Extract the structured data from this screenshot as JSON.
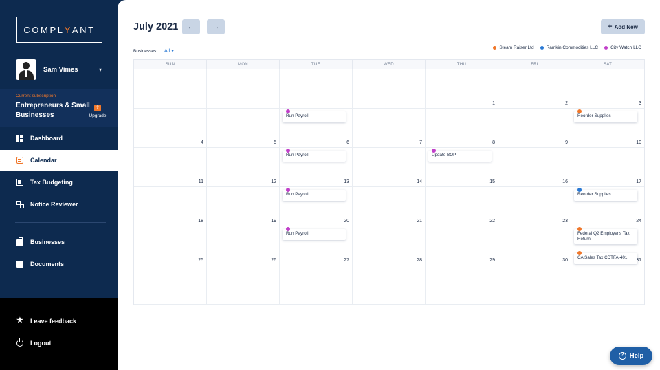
{
  "brand": {
    "logo_prefix": "COMPL",
    "logo_accent": "Y",
    "logo_suffix": "ANT"
  },
  "user": {
    "name": "Sam Vimes",
    "caret": "▾"
  },
  "subscription": {
    "label": "Current subscription",
    "plan": "Entrepreneurs & Small Businesses",
    "upgrade_label": "Upgrade"
  },
  "nav": {
    "dashboard": "Dashboard",
    "calendar": "Calendar",
    "tax_budgeting": "Tax Budgeting",
    "notice_reviewer": "Notice Reviewer",
    "businesses": "Businesses",
    "documents": "Documents",
    "leave_feedback": "Leave feedback",
    "logout": "Logout"
  },
  "header": {
    "month": "July 2021",
    "prev_arrow": "←",
    "next_arrow": "→",
    "add_new": "Add New",
    "add_icon": "+"
  },
  "filter": {
    "label": "Businesses:",
    "value": "All ▾"
  },
  "legend": [
    {
      "name": "Steam Raiser Ltd",
      "color": "#f0772a"
    },
    {
      "name": "Ramkin Commodities LLC",
      "color": "#2a79d4"
    },
    {
      "name": "City Watch LLC",
      "color": "#c13fc9"
    }
  ],
  "weekdays": [
    "SUN",
    "MON",
    "TUE",
    "WED",
    "THU",
    "FRI",
    "SAT"
  ],
  "days": [
    "",
    "",
    "",
    "",
    "1",
    "2",
    "3",
    "4",
    "5",
    "6",
    "7",
    "8",
    "9",
    "10",
    "11",
    "12",
    "13",
    "14",
    "15",
    "16",
    "17",
    "18",
    "19",
    "20",
    "21",
    "22",
    "23",
    "24",
    "25",
    "26",
    "27",
    "28",
    "29",
    "30",
    "31",
    "",
    "",
    "",
    "",
    "",
    "",
    ""
  ],
  "events": [
    {
      "cell": 9,
      "label": "Run Payroll",
      "color": "#c13fc9"
    },
    {
      "cell": 13,
      "label": "Reorder Supplies",
      "color": "#f0772a"
    },
    {
      "cell": 16,
      "label": "Run Payroll",
      "color": "#c13fc9"
    },
    {
      "cell": 18,
      "label": "Update BOP",
      "color": "#c13fc9"
    },
    {
      "cell": 23,
      "label": "Run Payroll",
      "color": "#c13fc9"
    },
    {
      "cell": 27,
      "label": "Reorder Supplies",
      "color": "#2a79d4"
    },
    {
      "cell": 30,
      "label": "Run Payroll",
      "color": "#c13fc9"
    },
    {
      "cell": 34,
      "label": "Federal Q2 Employer's Tax Return",
      "color": "#f0772a"
    },
    {
      "cell": 34,
      "label": "CA Sales Tax CDTFA-401",
      "color": "#f0772a",
      "stack": 1
    }
  ],
  "help": {
    "label": "Help",
    "icon": "?"
  }
}
